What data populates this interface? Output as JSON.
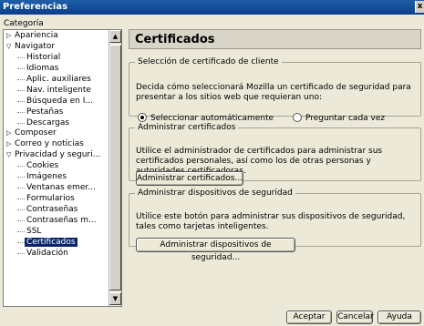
{
  "window": {
    "title": "Preferencias",
    "close_glyph": "x"
  },
  "sidebar": {
    "label": "Categoría",
    "items": [
      {
        "label": "Apariencia",
        "level": 0,
        "twisty": "closed",
        "selected": false
      },
      {
        "label": "Navigator",
        "level": 0,
        "twisty": "open",
        "selected": false
      },
      {
        "label": "Historial",
        "level": 1,
        "selected": false
      },
      {
        "label": "Idiomas",
        "level": 1,
        "selected": false
      },
      {
        "label": "Aplic. auxiliares",
        "level": 1,
        "selected": false
      },
      {
        "label": "Nav. inteligente",
        "level": 1,
        "selected": false
      },
      {
        "label": "Búsqueda en I...",
        "level": 1,
        "selected": false
      },
      {
        "label": "Pestañas",
        "level": 1,
        "selected": false
      },
      {
        "label": "Descargas",
        "level": 1,
        "selected": false
      },
      {
        "label": "Composer",
        "level": 0,
        "twisty": "closed",
        "selected": false
      },
      {
        "label": "Correo y noticias",
        "level": 0,
        "twisty": "closed",
        "selected": false
      },
      {
        "label": "Privacidad y seguri...",
        "level": 0,
        "twisty": "open",
        "selected": false
      },
      {
        "label": "Cookies",
        "level": 1,
        "selected": false
      },
      {
        "label": "Imágenes",
        "level": 1,
        "selected": false
      },
      {
        "label": "Ventanas emer...",
        "level": 1,
        "selected": false
      },
      {
        "label": "Formularios",
        "level": 1,
        "selected": false
      },
      {
        "label": "Contraseñas",
        "level": 1,
        "selected": false
      },
      {
        "label": "Contraseñas m...",
        "level": 1,
        "selected": false
      },
      {
        "label": "SSL",
        "level": 1,
        "selected": false
      },
      {
        "label": "Certificados",
        "level": 1,
        "selected": true
      },
      {
        "label": "Validación",
        "level": 1,
        "selected": false
      }
    ]
  },
  "panel": {
    "title": "Certificados",
    "client_cert": {
      "legend": "Selección de certificado de cliente",
      "description": "Decida cómo seleccionará Mozilla un certificado de seguridad para presentar a los sitios web que requieran uno:",
      "option_auto": "Seleccionar automáticamente",
      "option_ask": "Preguntar cada vez",
      "selected": "auto"
    },
    "manage_certs": {
      "legend": "Administrar certificados",
      "description": "Utilice el administrador de certificados para administrar sus certificados personales, así como los de otras personas y autoridades certificadoras.",
      "button": "Administrar certificados..."
    },
    "manage_devices": {
      "legend": "Administrar dispositivos de seguridad",
      "description": "Utilice este botón para administrar sus dispositivos de seguridad, tales como tarjetas inteligentes.",
      "button": "Administrar dispositivos de seguridad..."
    }
  },
  "footer": {
    "ok": "Aceptar",
    "cancel": "Cancelar",
    "help": "Ayuda"
  }
}
